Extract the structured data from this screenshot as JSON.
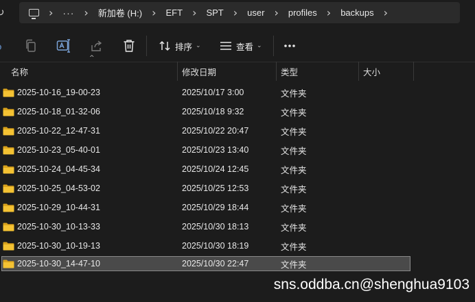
{
  "address": {
    "overflow_label": "···",
    "crumbs": [
      "新加卷 (H:)",
      "EFT",
      "SPT",
      "user",
      "profiles",
      "backups"
    ]
  },
  "toolbar": {
    "sort_label": "排序",
    "view_label": "查看",
    "more_label": "···"
  },
  "columns": {
    "name": "名称",
    "modified": "修改日期",
    "type": "类型",
    "size": "大小"
  },
  "rows": [
    {
      "name": "2025-10-16_19-00-23",
      "modified": "2025/10/17 3:00",
      "type": "文件夹",
      "size": ""
    },
    {
      "name": "2025-10-18_01-32-06",
      "modified": "2025/10/18 9:32",
      "type": "文件夹",
      "size": ""
    },
    {
      "name": "2025-10-22_12-47-31",
      "modified": "2025/10/22 20:47",
      "type": "文件夹",
      "size": ""
    },
    {
      "name": "2025-10-23_05-40-01",
      "modified": "2025/10/23 13:40",
      "type": "文件夹",
      "size": ""
    },
    {
      "name": "2025-10-24_04-45-34",
      "modified": "2025/10/24 12:45",
      "type": "文件夹",
      "size": ""
    },
    {
      "name": "2025-10-25_04-53-02",
      "modified": "2025/10/25 12:53",
      "type": "文件夹",
      "size": ""
    },
    {
      "name": "2025-10-29_10-44-31",
      "modified": "2025/10/29 18:44",
      "type": "文件夹",
      "size": ""
    },
    {
      "name": "2025-10-30_10-13-33",
      "modified": "2025/10/30 18:13",
      "type": "文件夹",
      "size": ""
    },
    {
      "name": "2025-10-30_10-19-13",
      "modified": "2025/10/30 18:19",
      "type": "文件夹",
      "size": ""
    },
    {
      "name": "2025-10-30_14-47-10",
      "modified": "2025/10/30 22:47",
      "type": "文件夹",
      "size": "",
      "selected": true
    }
  ],
  "watermark": "sns.oddba.cn@shenghua9103",
  "colors": {
    "background": "#1c1c1c",
    "address_bg": "#2b2b2b",
    "folder": "#f4c233",
    "selection": "#4a4a4a"
  },
  "icons": {
    "computer": "computer-icon",
    "copy": "copy-icon",
    "rename": "rename-icon",
    "share": "share-icon",
    "delete": "trash-icon",
    "sort": "sort-icon",
    "view": "view-icon",
    "folder": "folder-icon"
  }
}
